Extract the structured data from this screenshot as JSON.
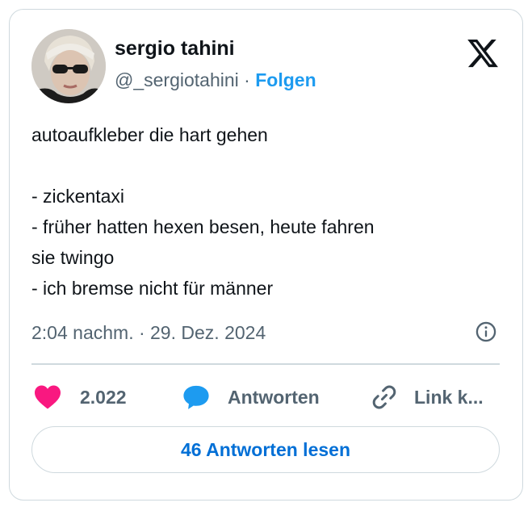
{
  "author": {
    "name": "sergio tahini",
    "handle": "@_sergiotahini",
    "separator": "·",
    "follow_label": "Folgen"
  },
  "tweet": {
    "lines": [
      "autoaufkleber die hart gehen",
      "",
      "- zickentaxi",
      "- früher hatten hexen besen, heute fahren",
      "sie twingo",
      "- ich bremse nicht für männer"
    ],
    "timestamp": "2:04 nachm. · 29. Dez. 2024"
  },
  "actions": {
    "like_count": "2.022",
    "reply_label": "Antworten",
    "link_label": "Link k..."
  },
  "read_replies_label": "46 Antworten lesen",
  "icons": {
    "like": "heart-icon",
    "reply": "speech-bubble-icon",
    "link": "link-icon",
    "info": "info-icon",
    "brand": "x-logo-icon"
  },
  "colors": {
    "like": "#f91880",
    "reply": "#1d9bf0",
    "accent": "#1d9bf0",
    "button_text": "#006fd6",
    "secondary_text": "#536471",
    "border": "#cfd9de"
  }
}
